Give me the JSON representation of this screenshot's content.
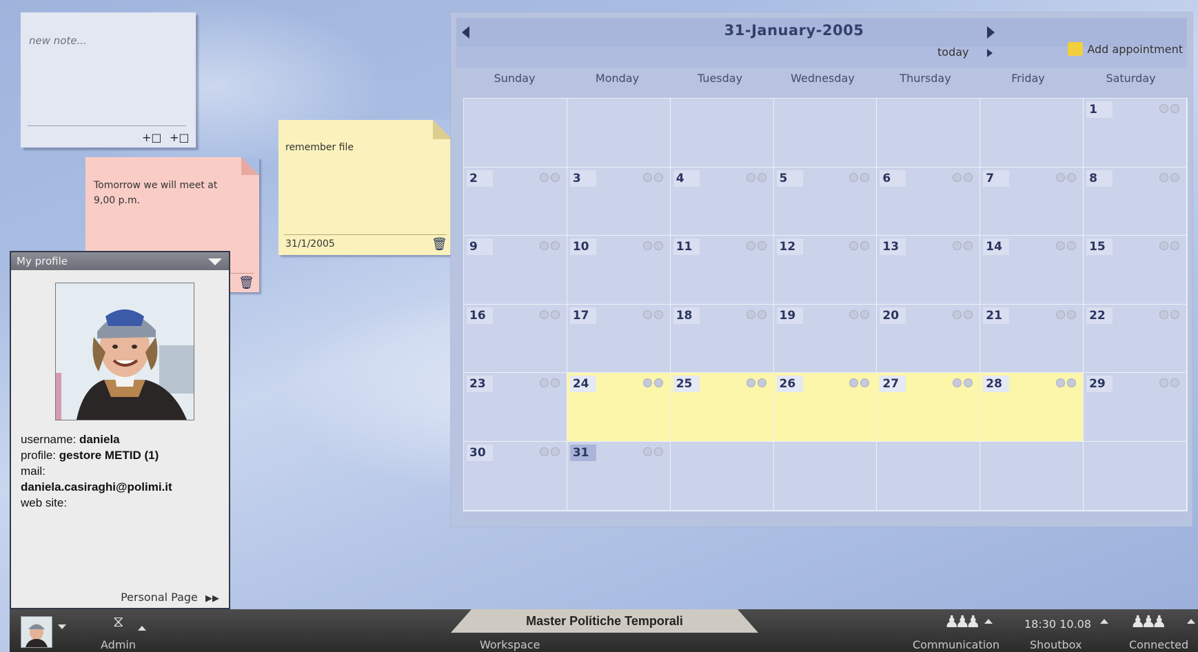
{
  "new_note": {
    "placeholder": "new note..."
  },
  "notes": [
    {
      "text": "Tomorrow we will meet at 9,00 p.m.",
      "color": "#f9cdc6"
    },
    {
      "text": "remember file",
      "date": "31/1/2005",
      "color": "#faf1bc"
    }
  ],
  "profile": {
    "header": "My profile",
    "username_label": "username: ",
    "username": "daniela",
    "profile_label": "profile: ",
    "profile": "gestore METID (1)",
    "mail_label": "mail:",
    "mail": "daniela.casiraghi@polimi.it",
    "website_label": "web site:",
    "personal_page": "Personal Page"
  },
  "calendar": {
    "title": "31-January-2005",
    "today_label": "today",
    "add_appointment": "Add appointment",
    "weekdays": [
      "Sunday",
      "Monday",
      "Tuesday",
      "Wednesday",
      "Thursday",
      "Friday",
      "Saturday"
    ],
    "first_weekday_index": 6,
    "days_in_month": 31,
    "current_day": 31,
    "highlighted_days": [
      24,
      25,
      26,
      27,
      28
    ],
    "highlight_color": "#fbf6a9"
  },
  "taskbar": {
    "admin_label": "Admin",
    "workspace_title": "Master Politiche Temporali",
    "workspace_label": "Workspace",
    "communication_label": "Communication",
    "clock": "18:30 10.08",
    "shoutbox_label": "Shoutbox",
    "connected_label": "Connected"
  }
}
